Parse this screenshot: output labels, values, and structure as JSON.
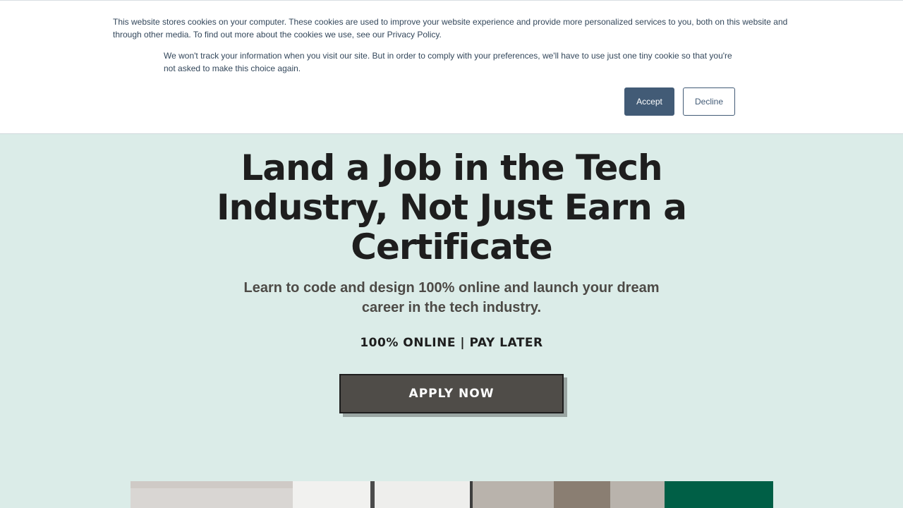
{
  "cookie_banner": {
    "main_text": "This website stores cookies on your computer. These cookies are used to improve your website experience and provide more personalized services to you, both on this website and through other media. To find out more about the cookies we use, see our Privacy Policy.",
    "secondary_text": "We won't track your information when you visit our site. But in order to comply with your preferences, we'll have to use just one tiny cookie so that you're not asked to make this choice again.",
    "accept_label": "Accept",
    "decline_label": "Decline",
    "accept_color": "#425b76"
  },
  "hero": {
    "title": "Land a Job in the Tech Industry, Not Just Earn a Certificate",
    "subtitle": "Learn to code and design 100% online and launch your dream career in the tech industry.",
    "tagline": "100% ONLINE | PAY LATER",
    "cta_label": "APPLY NOW",
    "background_color": "#dbece8",
    "cta_color": "#4f4c48"
  }
}
